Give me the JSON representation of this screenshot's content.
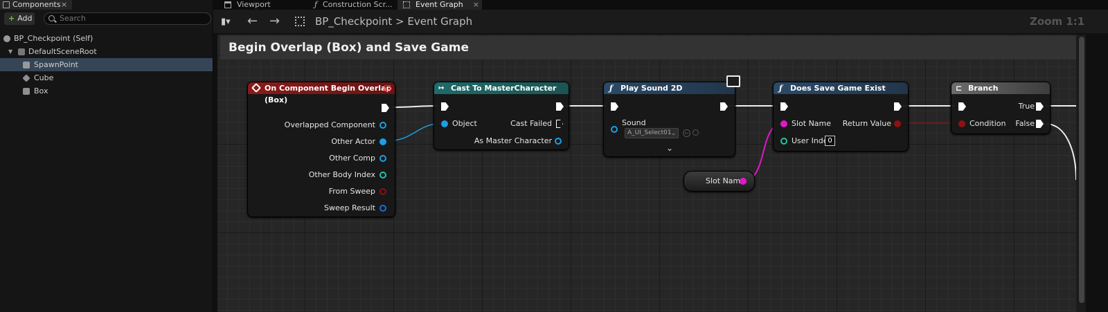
{
  "components_panel": {
    "tab_label": "Components",
    "add_label": "Add",
    "search_placeholder": "Search",
    "tree": [
      {
        "label": "BP_Checkpoint (Self)",
        "icon": "blueprint-self-icon"
      },
      {
        "label": "DefaultSceneRoot",
        "icon": "scene-root-icon"
      },
      {
        "label": "SpawnPoint",
        "icon": "scene-component-icon",
        "selected": true
      },
      {
        "label": "Cube",
        "icon": "cube-mesh-icon"
      },
      {
        "label": "Box",
        "icon": "box-collision-icon"
      }
    ]
  },
  "tabs": [
    {
      "label": "Viewport",
      "icon": "viewport-icon"
    },
    {
      "label": "Construction Scr...",
      "icon": "function-icon"
    },
    {
      "label": "Event Graph",
      "icon": "event-graph-icon",
      "active": true
    }
  ],
  "toolbar": {
    "breadcrumb_root": "BP_Checkpoint",
    "breadcrumb_separator": ">",
    "breadcrumb_current": "Event Graph",
    "zoom": "Zoom 1:1"
  },
  "graph": {
    "comment_title": "Begin Overlap (Box) and Save Game",
    "nodes": {
      "overlap": {
        "title": "On Component Begin Overlap (Box)",
        "header_color": "#8b1a1a",
        "pins": [
          "Overlapped Component",
          "Other Actor",
          "Other Comp",
          "Other Body Index",
          "From Sweep",
          "Sweep Result"
        ]
      },
      "cast": {
        "title": "Cast To MasterCharacter",
        "header_color": "#1f6b6a",
        "input": "Object",
        "outputs": [
          "Cast Failed",
          "As Master Character"
        ]
      },
      "sound": {
        "title": "Play Sound 2D",
        "header_color": "#2b4a68",
        "input": "Sound",
        "asset": "A_UI_Select01"
      },
      "exists": {
        "title": "Does Save Game Exist",
        "header_color": "#2b4a68",
        "inputs": [
          "Slot Name",
          "User Index"
        ],
        "user_index_value": "0",
        "output": "Return Value"
      },
      "branch": {
        "title": "Branch",
        "header_color": "#6b6b6b",
        "input": "Condition",
        "outputs": [
          "True",
          "False"
        ]
      },
      "slot_var": {
        "label": "Slot Name"
      }
    }
  },
  "colors": {
    "object_pin": "#1ba0e6",
    "int_pin": "#1fc7a0",
    "bool_pin": "#8e1111",
    "string_pin": "#e019c8",
    "struct_pin": "#1b6fd6",
    "selection": "#354556"
  }
}
